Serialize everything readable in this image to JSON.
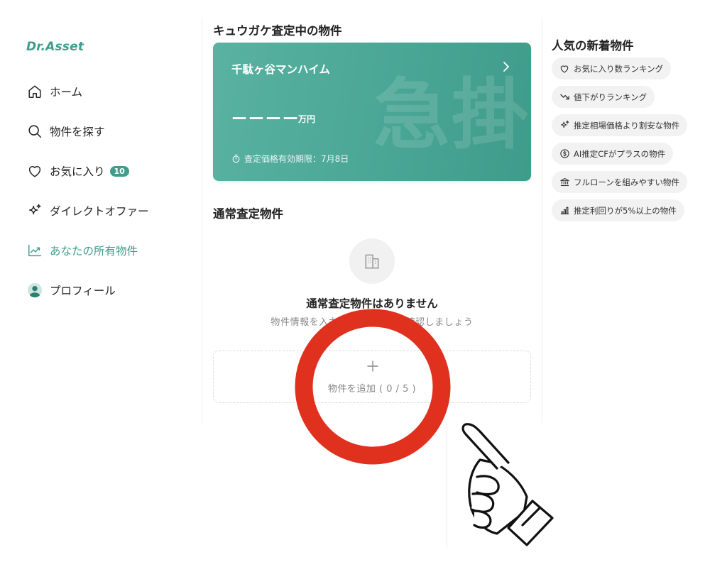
{
  "brand": {
    "logo_text": "Dr.Asset",
    "accent_color": "#3f9d8b"
  },
  "sidebar": {
    "items": [
      {
        "label": "ホーム",
        "icon": "home-icon"
      },
      {
        "label": "物件を探す",
        "icon": "search-icon"
      },
      {
        "label": "お気に入り",
        "icon": "heart-icon",
        "badge": "10"
      },
      {
        "label": "ダイレクトオファー",
        "icon": "sparkle-icon"
      },
      {
        "label": "あなたの所有物件",
        "icon": "trend-chart-icon",
        "active": true
      },
      {
        "label": "プロフィール",
        "icon": "user-avatar-icon"
      }
    ]
  },
  "main": {
    "urgent_section": {
      "title": "キュウガケ査定中の物件",
      "card": {
        "property_name": "千駄ヶ谷マンハイム",
        "price_masked": "ーーーー",
        "price_unit": "万円",
        "expiry": "査定価格有効期限：7月8日",
        "watermark": "急掛",
        "card_color": "#4aa695"
      }
    },
    "normal_section": {
      "title": "通常査定物件",
      "empty_title": "通常査定物件はありません",
      "empty_subtitle": "物件情報を入力して査定価格を確認しましょう",
      "add_label": "物件を追加 ( 0 / 5 )"
    }
  },
  "right_panel": {
    "title": "人気の新着物件",
    "chips": [
      {
        "label": "お気に入り数ランキング",
        "icon": "heart-icon"
      },
      {
        "label": "値下がりランキング",
        "icon": "trend-down-icon"
      },
      {
        "label": "推定相場価格より割安な物件",
        "icon": "sparkle-icon"
      },
      {
        "label": "AI推定CFがプラスの物件",
        "icon": "dollar-circle-icon"
      },
      {
        "label": "フルローンを組みやすい物件",
        "icon": "bank-icon"
      },
      {
        "label": "推定利回りが5%以上の物件",
        "icon": "bar-chart-icon"
      }
    ]
  },
  "annotation": {
    "highlight_color": "#e0301e",
    "icons": [
      "red-circle-highlight",
      "pointing-hand-icon"
    ]
  }
}
